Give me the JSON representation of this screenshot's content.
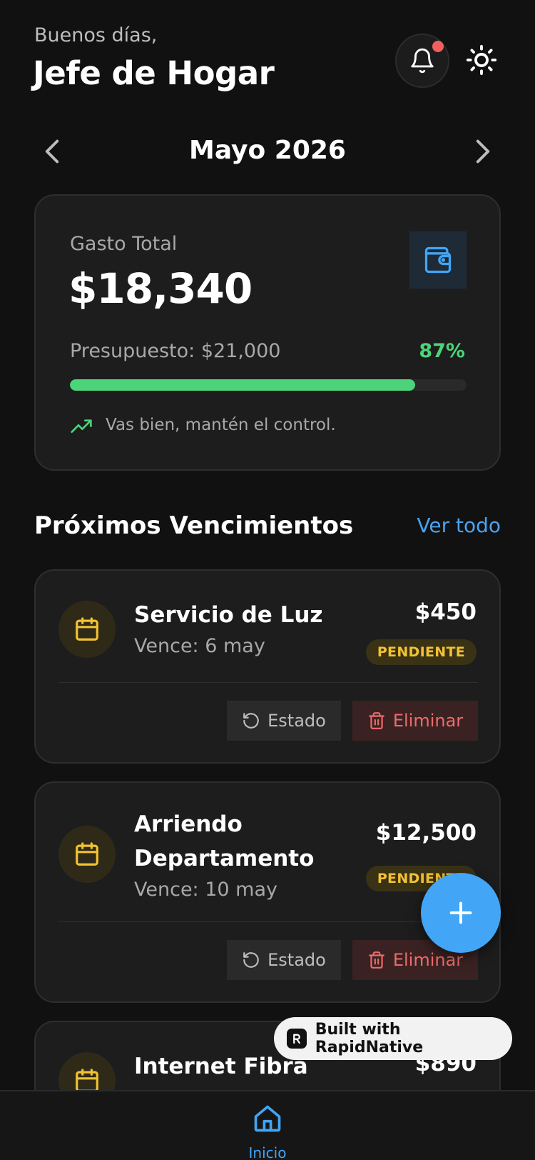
{
  "header": {
    "greeting": "Buenos días,",
    "user_name": "Jefe de Hogar"
  },
  "month_nav": {
    "label": "Mayo 2026"
  },
  "summary": {
    "total_label": "Gasto Total",
    "total_value": "$18,340",
    "budget_label": "Presupuesto: $21,000",
    "budget_percent": "87%",
    "progress_fraction": 0.87,
    "status_message": "Vas bien, mantén el control."
  },
  "upcoming": {
    "title": "Próximos Vencimientos",
    "view_all_label": "Ver todo",
    "bills": [
      {
        "name": "Servicio de Luz",
        "due": "Vence: 6 may",
        "amount": "$450",
        "status": "PENDIENTE",
        "estado_label": "Estado",
        "eliminar_label": "Eliminar"
      },
      {
        "name": "Arriendo Departamento",
        "due": "Vence: 10 may",
        "amount": "$12,500",
        "status": "PENDIENTE",
        "estado_label": "Estado",
        "eliminar_label": "Eliminar"
      },
      {
        "name": "Internet Fibra",
        "amount": "$890"
      }
    ]
  },
  "built_badge": {
    "label": "Built with RapidNative"
  },
  "bottom_nav": {
    "home_label": "Inicio"
  },
  "colors": {
    "background": "#111111",
    "card": "#1d1d1d",
    "accent_blue": "#42a5f5",
    "accent_green": "#4cd47a",
    "warning_yellow": "#f2c232",
    "danger_red": "#ef6b6b",
    "notification_dot": "#f25f5c"
  },
  "icons": {
    "bell": "bell-icon",
    "theme": "sun-icon",
    "wallet": "wallet-icon",
    "trend": "trending-up-icon",
    "calendar": "calendar-icon",
    "reset": "rotate-ccw-icon",
    "trash": "trash-icon",
    "add": "plus-icon",
    "home": "home-icon"
  }
}
